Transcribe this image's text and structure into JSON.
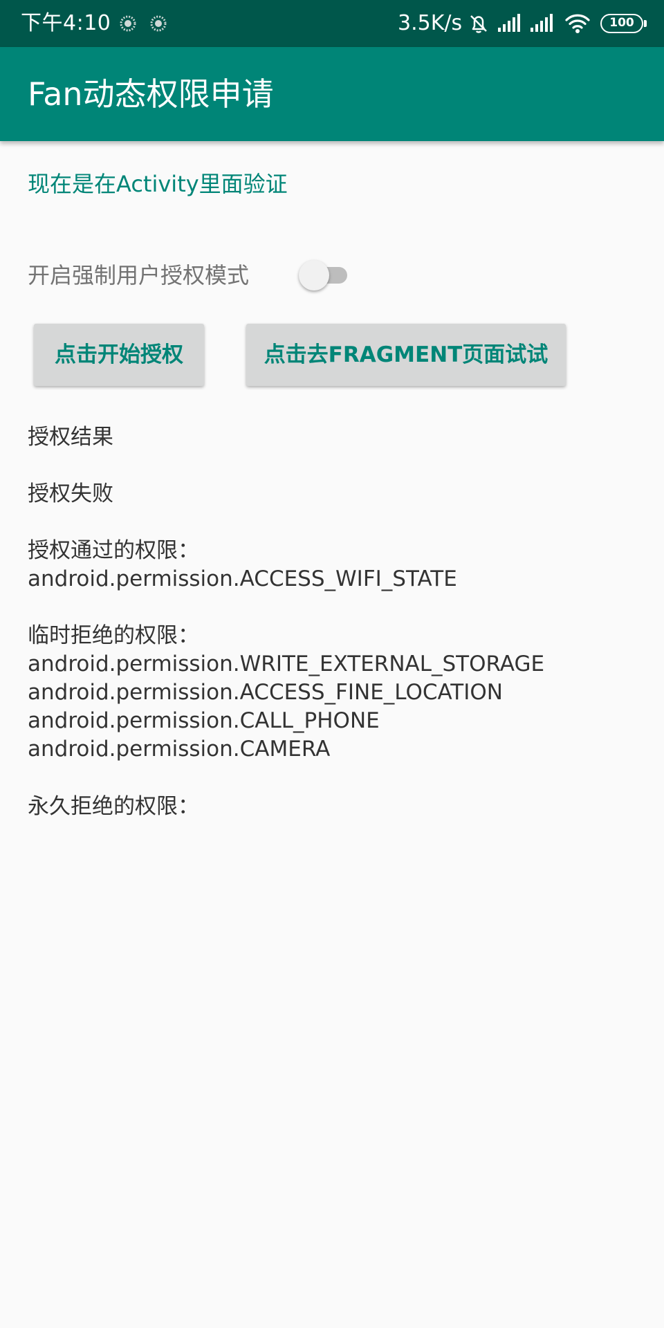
{
  "status_bar": {
    "time": "下午4:10",
    "net_speed": "3.5K/s",
    "battery": "100",
    "icons": [
      "notification-dot-icon",
      "notification-dot-icon",
      "alarm-off-icon",
      "signal-icon",
      "signal-icon",
      "wifi-icon",
      "battery-icon"
    ]
  },
  "app_bar": {
    "title": "Fan动态权限申请"
  },
  "main": {
    "subtitle": "现在是在Activity里面验证",
    "force_mode_label": "开启强制用户授权模式",
    "force_mode_enabled": false,
    "start_button": "点击开始授权",
    "fragment_button": "点击去FRAGMENT页面试试",
    "result_title": "授权结果",
    "result_status": "授权失败",
    "granted": {
      "label": "授权通过的权限：",
      "items": [
        "android.permission.ACCESS_WIFI_STATE"
      ]
    },
    "denied": {
      "label": "临时拒绝的权限：",
      "items": [
        "android.permission.WRITE_EXTERNAL_STORAGE",
        "android.permission.ACCESS_FINE_LOCATION",
        "android.permission.CALL_PHONE",
        "android.permission.CAMERA"
      ]
    },
    "permanently_denied": {
      "label": "永久拒绝的权限：",
      "items": []
    }
  },
  "colors": {
    "status_bar": "#00574b",
    "primary": "#008577",
    "background": "#fafafa",
    "button": "#d6d7d7",
    "text": "#333333"
  }
}
